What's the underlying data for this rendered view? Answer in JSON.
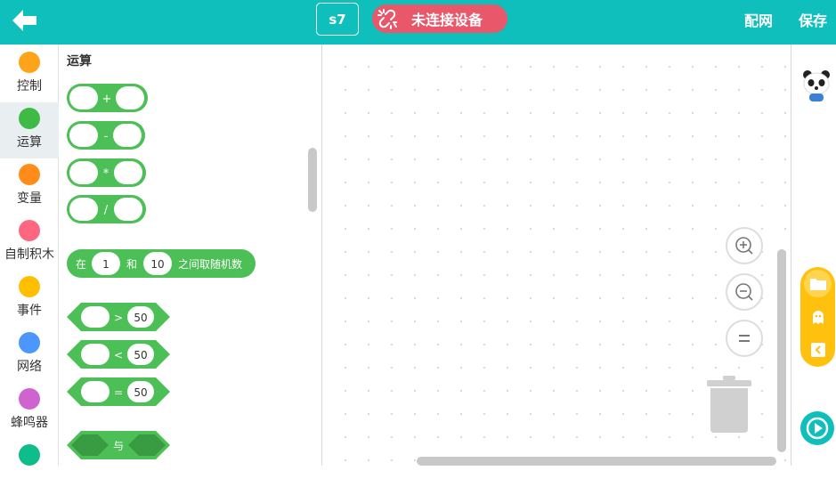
{
  "topbar": {
    "device_name": "s7",
    "connection_status": "未连接设备",
    "network_label": "配网",
    "save_label": "保存",
    "color": "#0fbfbb"
  },
  "categories": [
    {
      "label": "控制",
      "color": "#ffa31a",
      "selected": false
    },
    {
      "label": "运算",
      "color": "#3dbb46",
      "selected": true
    },
    {
      "label": "变量",
      "color": "#ff8c1a",
      "selected": false
    },
    {
      "label": "自制积木",
      "color": "#ff6680",
      "selected": false
    },
    {
      "label": "事件",
      "color": "#ffbf00",
      "selected": false
    },
    {
      "label": "网络",
      "color": "#4c97ff",
      "selected": false
    },
    {
      "label": "蜂鸣器",
      "color": "#cf63cf",
      "selected": false
    },
    {
      "label": "",
      "color": "#0fbd8c",
      "selected": false
    }
  ],
  "palette": {
    "title": "运算",
    "block_color": "#4cbf56",
    "ops": [
      "+",
      "-",
      "*",
      "/"
    ],
    "random": {
      "prefix": "在",
      "from": "1",
      "middle": "和",
      "to": "10",
      "suffix": "之间取随机数"
    },
    "comparisons": [
      {
        "op": ">",
        "value": "50"
      },
      {
        "op": "<",
        "value": "50"
      },
      {
        "op": "=",
        "value": "50"
      }
    ],
    "logic_and": "与"
  },
  "workspace": {
    "zoom_in_icon": "zoom-in-icon",
    "zoom_out_icon": "zoom-out-icon",
    "reset_icon": "zoom-reset-icon",
    "trash_icon": "trash-icon"
  }
}
